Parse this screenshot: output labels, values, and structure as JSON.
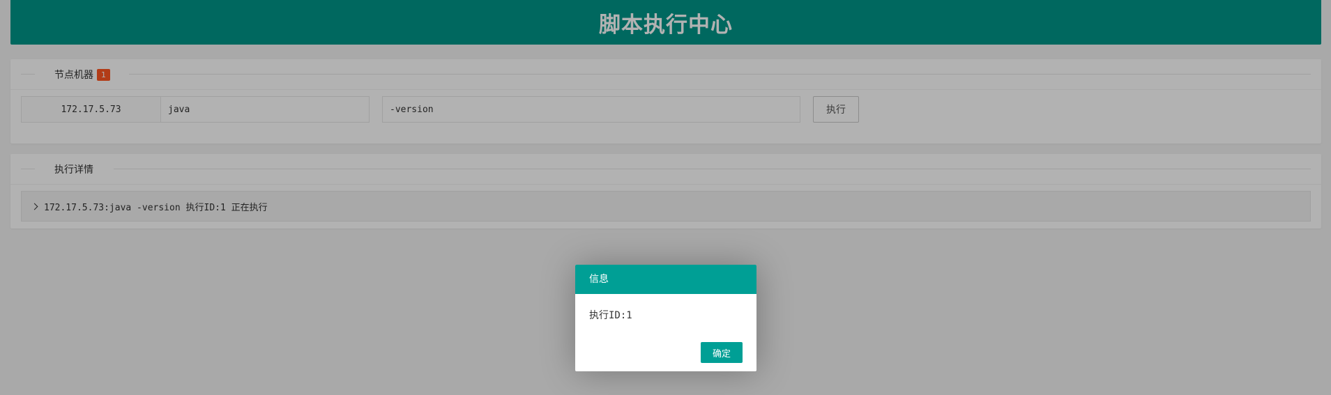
{
  "header": {
    "title": "脚本执行中心"
  },
  "nodes_section": {
    "legend": "节点机器",
    "badge_count": "1",
    "ip": "172.17.5.73",
    "command_value": "java",
    "args_value": "-version",
    "execute_label": "执行"
  },
  "details_section": {
    "legend": "执行详情",
    "row_text": "172.17.5.73:java -version 执行ID:1 正在执行"
  },
  "dialog": {
    "title": "信息",
    "message": "执行ID:1",
    "ok_label": "确定"
  },
  "colors": {
    "primary": "#009688",
    "dialog_header": "#009f95",
    "badge": "#ff5722"
  }
}
